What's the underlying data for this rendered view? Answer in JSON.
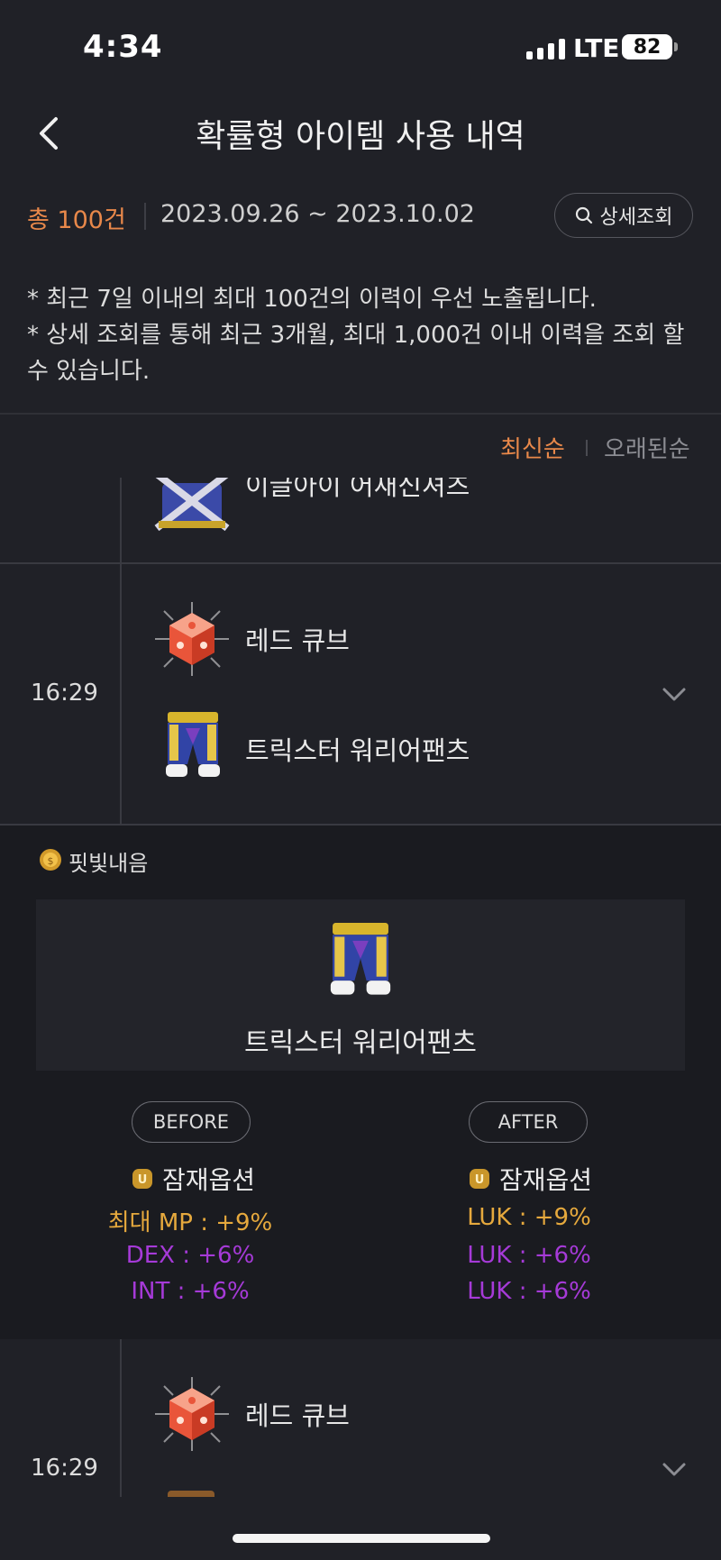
{
  "status_bar": {
    "time": "4:34",
    "network": "LTE",
    "battery": "82"
  },
  "header": {
    "title": "확률형 아이템 사용 내역"
  },
  "filter": {
    "count": "총 100건",
    "date_range": "2023.09.26 ~ 2023.10.02",
    "search_label": "상세조회"
  },
  "notice": {
    "line1": "* 최근 7일 이내의 최대 100건의 이력이 우선 노출됩니다.",
    "line2": "* 상세 조회를 통해 최근 3개월, 최대 1,000건 이내 이력을 조회 할 수 있습니다."
  },
  "sort": {
    "latest": "최신순",
    "oldest": "오래된순"
  },
  "entries": [
    {
      "time": "",
      "items": [
        "이글아이 어새신셔츠"
      ]
    },
    {
      "time": "16:29",
      "items": [
        "레드 큐브",
        "트릭스터 워리어팬츠"
      ]
    },
    {
      "time": "16:29",
      "items": [
        "레드 큐브"
      ]
    }
  ],
  "detail": {
    "label": "핏빛내음",
    "item_name": "트릭스터 워리어팬츠",
    "before": {
      "pill": "BEFORE",
      "title": "잠재옵션",
      "options": [
        {
          "text": "최대 MP : +9%",
          "grade": "legendary"
        },
        {
          "text": "DEX : +6%",
          "grade": "unique"
        },
        {
          "text": "INT : +6%",
          "grade": "unique"
        }
      ]
    },
    "after": {
      "pill": "AFTER",
      "title": "잠재옵션",
      "options": [
        {
          "text": "LUK : +9%",
          "grade": "legendary"
        },
        {
          "text": "LUK : +6%",
          "grade": "unique"
        },
        {
          "text": "LUK : +6%",
          "grade": "unique"
        }
      ]
    }
  },
  "colors": {
    "accent": "#e8884a",
    "legendary": "#e6a93d",
    "unique": "#a63ad8",
    "background": "#202127"
  }
}
